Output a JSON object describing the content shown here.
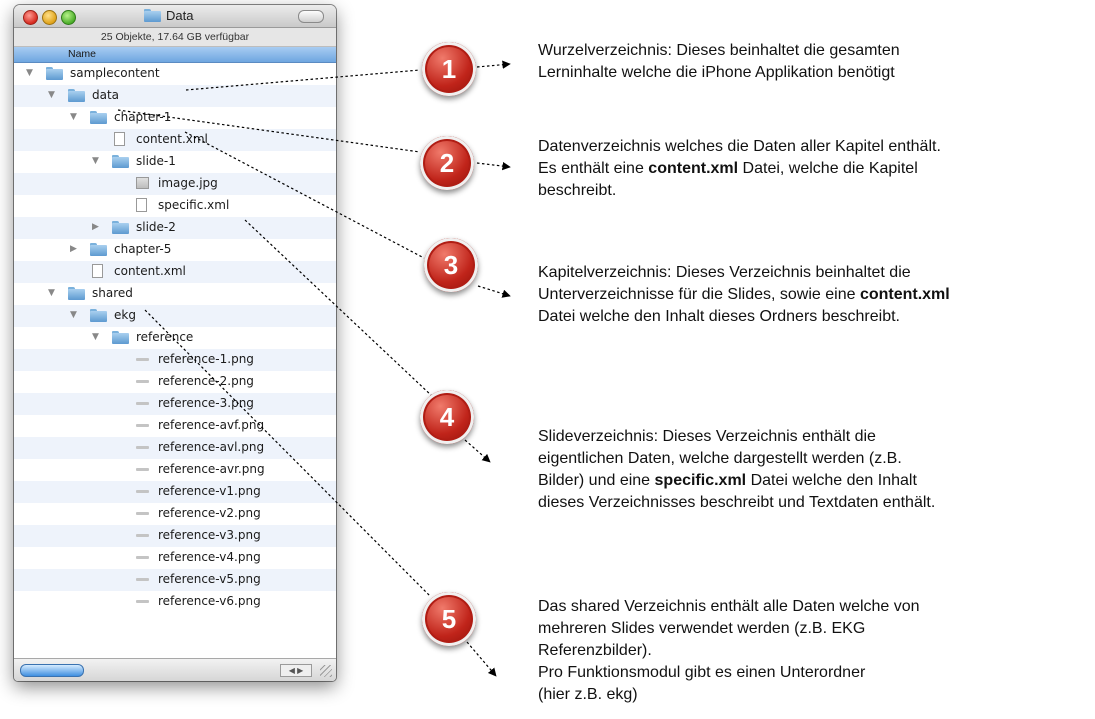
{
  "window": {
    "title": "Data",
    "status": "25 Objekte, 17.64 GB verfügbar",
    "column_header": "Name"
  },
  "tree": [
    {
      "label": "samplecontent",
      "type": "folder",
      "indent": 0,
      "expanded": true
    },
    {
      "label": "data",
      "type": "folder",
      "indent": 1,
      "expanded": true
    },
    {
      "label": "chapter-1",
      "type": "folder",
      "indent": 2,
      "expanded": true
    },
    {
      "label": "content.xml",
      "type": "doc",
      "indent": 3
    },
    {
      "label": "slide-1",
      "type": "folder",
      "indent": 3,
      "expanded": true
    },
    {
      "label": "image.jpg",
      "type": "image",
      "indent": 4
    },
    {
      "label": "specific.xml",
      "type": "doc",
      "indent": 4
    },
    {
      "label": "slide-2",
      "type": "folder",
      "indent": 3,
      "expanded": false
    },
    {
      "label": "chapter-5",
      "type": "folder",
      "indent": 2,
      "expanded": false
    },
    {
      "label": "content.xml",
      "type": "doc",
      "indent": 2
    },
    {
      "label": "shared",
      "type": "folder",
      "indent": 1,
      "expanded": true
    },
    {
      "label": "ekg",
      "type": "folder",
      "indent": 2,
      "expanded": true
    },
    {
      "label": "reference",
      "type": "folder",
      "indent": 3,
      "expanded": true
    },
    {
      "label": "reference-1.png",
      "type": "png",
      "indent": 4
    },
    {
      "label": "reference-2.png",
      "type": "png",
      "indent": 4
    },
    {
      "label": "reference-3.png",
      "type": "png",
      "indent": 4
    },
    {
      "label": "reference-avf.png",
      "type": "png",
      "indent": 4
    },
    {
      "label": "reference-avl.png",
      "type": "png",
      "indent": 4
    },
    {
      "label": "reference-avr.png",
      "type": "png",
      "indent": 4
    },
    {
      "label": "reference-v1.png",
      "type": "png",
      "indent": 4
    },
    {
      "label": "reference-v2.png",
      "type": "png",
      "indent": 4
    },
    {
      "label": "reference-v3.png",
      "type": "png",
      "indent": 4
    },
    {
      "label": "reference-v4.png",
      "type": "png",
      "indent": 4
    },
    {
      "label": "reference-v5.png",
      "type": "png",
      "indent": 4
    },
    {
      "label": "reference-v6.png",
      "type": "png",
      "indent": 4
    }
  ],
  "callouts": [
    {
      "number": "1",
      "parts": [
        {
          "t": "Wurzelverzeichnis: Dieses beinhaltet die gesamten",
          "br": true
        },
        {
          "t": "Lerninhalte welche die iPhone Applikation benötigt"
        }
      ]
    },
    {
      "number": "2",
      "parts": [
        {
          "t": "Datenverzeichnis welches die Daten aller Kapitel enthält.",
          "br": true
        },
        {
          "t": "Es enthält eine "
        },
        {
          "t": "content.xml",
          "b": true
        },
        {
          "t": " Datei, welche die Kapitel",
          "br": true
        },
        {
          "t": "beschreibt."
        }
      ]
    },
    {
      "number": "3",
      "parts": [
        {
          "t": "Kapitelverzeichnis: Dieses Verzeichnis beinhaltet die",
          "br": true
        },
        {
          "t": "Unterverzeichnisse für die Slides, sowie eine "
        },
        {
          "t": "content.xml",
          "b": true,
          "br": true
        },
        {
          "t": "Datei welche den Inhalt dieses Ordners beschreibt."
        }
      ]
    },
    {
      "number": "4",
      "parts": [
        {
          "t": "Slideverzeichnis: Dieses Verzeichnis enthält die",
          "br": true
        },
        {
          "t": "eigentlichen Daten, welche dargestellt werden (z.B.",
          "br": true
        },
        {
          "t": "Bilder) und eine "
        },
        {
          "t": "specific.xml",
          "b": true
        },
        {
          "t": " Datei welche den Inhalt",
          "br": true
        },
        {
          "t": "dieses Verzeichnisses beschreibt und Textdaten enthält."
        }
      ]
    },
    {
      "number": "5",
      "parts": [
        {
          "t": "Das shared Verzeichnis enthält alle Daten welche von",
          "br": true
        },
        {
          "t": "mehreren Slides verwendet werden (z.B. EKG",
          "br": true
        },
        {
          "t": "Referenzbilder).",
          "br": true
        },
        {
          "t": "Pro Funktionsmodul gibt es einen Unterordner",
          "br": true
        },
        {
          "t": "(hier z.B. ekg)"
        }
      ]
    }
  ]
}
